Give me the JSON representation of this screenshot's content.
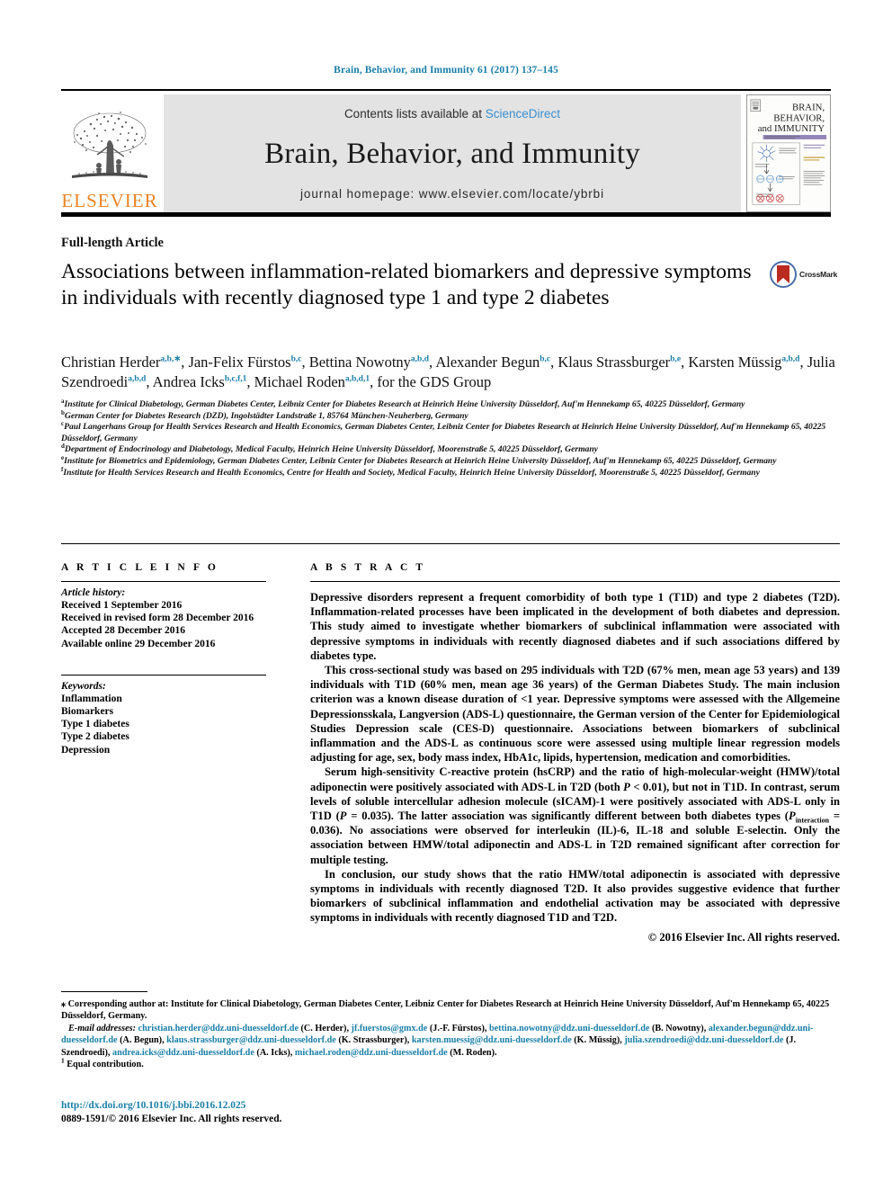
{
  "running_head": "Brain, Behavior, and Immunity 61 (2017) 137–145",
  "masthead": {
    "publisher_name": "ELSEVIER",
    "contents_prefix": "Contents lists available at ",
    "contents_link": "ScienceDirect",
    "journal_name": "Brain, Behavior, and Immunity",
    "homepage": "journal homepage: www.elsevier.com/locate/ybrbi",
    "cover_title_line1": "BRAIN,",
    "cover_title_line2": "BEHAVIOR,",
    "cover_title_line3": "and IMMUNITY"
  },
  "article": {
    "type": "Full-length Article",
    "title": "Associations between inflammation-related biomarkers and depressive symptoms in individuals with recently diagnosed type 1 and type 2 diabetes",
    "crossmark_label": "CrossMark"
  },
  "authors": [
    {
      "name": "Christian Herder",
      "sup": "a,b,∗",
      "sep": ", "
    },
    {
      "name": "Jan-Felix Fürstos",
      "sup": "b,c",
      "sep": ", "
    },
    {
      "name": "Bettina Nowotny",
      "sup": "a,b,d",
      "sep": ", "
    },
    {
      "name": "Alexander Begun",
      "sup": "b,c",
      "sep": ", "
    },
    {
      "name": "Klaus Strassburger",
      "sup": "b,e",
      "sep": ", "
    },
    {
      "name": "Karsten Müssig",
      "sup": "a,b,d",
      "sep": ", "
    },
    {
      "name": "Julia Szendroedi",
      "sup": "a,b,d",
      "sep": ", "
    },
    {
      "name": "Andrea Icks",
      "sup": "b,c,f,1",
      "sep": ", "
    },
    {
      "name": "Michael Roden",
      "sup": "a,b,d,1",
      "sep": ", "
    }
  ],
  "authors_trailing": "for the GDS Group",
  "affiliations": [
    {
      "marker": "a",
      "text": "Institute for Clinical Diabetology, German Diabetes Center, Leibniz Center for Diabetes Research at Heinrich Heine University Düsseldorf, Auf'm Hennekamp 65, 40225 Düsseldorf, Germany"
    },
    {
      "marker": "b",
      "text": "German Center for Diabetes Research (DZD), Ingolstädter Landstraße 1, 85764 München-Neuherberg, Germany"
    },
    {
      "marker": "c",
      "text": "Paul Langerhans Group for Health Services Research and Health Economics, German Diabetes Center, Leibniz Center for Diabetes Research at Heinrich Heine University Düsseldorf, Auf'm Hennekamp 65, 40225 Düsseldorf, Germany"
    },
    {
      "marker": "d",
      "text": "Department of Endocrinology and Diabetology, Medical Faculty, Heinrich Heine University Düsseldorf, Moorenstraße 5, 40225 Düsseldorf, Germany"
    },
    {
      "marker": "e",
      "text": "Institute for Biometrics and Epidemiology, German Diabetes Center, Leibniz Center for Diabetes Research at Heinrich Heine University Düsseldorf, Auf'm Hennekamp 65, 40225 Düsseldorf, Germany"
    },
    {
      "marker": "f",
      "text": "Institute for Health Services Research and Health Economics, Centre for Health and Society, Medical Faculty, Heinrich Heine University Düsseldorf, Moorenstraße 5, 40225 Düsseldorf, Germany"
    }
  ],
  "article_info": {
    "heading": "A R T I C L E  I N F O",
    "history_label": "Article history:",
    "history": [
      "Received 1 September 2016",
      "Received in revised form 28 December 2016",
      "Accepted 28 December 2016",
      "Available online 29 December 2016"
    ],
    "keywords_label": "Keywords:",
    "keywords": [
      "Inflammation",
      "Biomarkers",
      "Type 1 diabetes",
      "Type 2 diabetes",
      "Depression"
    ]
  },
  "abstract": {
    "heading": "A B S T R A C T",
    "paragraph1": "Depressive disorders represent a frequent comorbidity of both type 1 (T1D) and type 2 diabetes (T2D). Inflammation-related processes have been implicated in the development of both diabetes and depression. This study aimed to investigate whether biomarkers of subclinical inflammation were associated with depressive symptoms in individuals with recently diagnosed diabetes and if such associations differed by diabetes type.",
    "paragraph2": "This cross-sectional study was based on 295 individuals with T2D (67% men, mean age 53 years) and 139 individuals with T1D (60% men, mean age 36 years) of the German Diabetes Study. The main inclusion criterion was a known disease duration of <1 year. Depressive symptoms were assessed with the Allgemeine Depressionsskala, Langversion (ADS-L) questionnaire, the German version of the Center for Epidemiological Studies Depression scale (CES-D) questionnaire. Associations between biomarkers of subclinical inflammation and the ADS-L as continuous score were assessed using multiple linear regression models adjusting for age, sex, body mass index, HbA1c, lipids, hypertension, medication and comorbidities.",
    "paragraph3_a": "Serum high-sensitivity C-reactive protein (hsCRP) and the ratio of high-molecular-weight (HMW)/total adiponectin were positively associated with ADS-L in T2D (both ",
    "paragraph3_p1": "P",
    "paragraph3_b": " < 0.01), but not in T1D. In contrast, serum levels of soluble intercellular adhesion molecule (sICAM)-1 were positively associated with ADS-L only in T1D (",
    "paragraph3_p2": "P",
    "paragraph3_c": " = 0.035). The latter association was significantly different between both diabetes types (",
    "paragraph3_p3": "P",
    "paragraph3_sub": "interaction",
    "paragraph3_d": " = 0.036). No associations were observed for interleukin (IL)-6, IL-18 and soluble E-selectin. Only the association between HMW/total adiponectin and ADS-L in T2D remained significant after correction for multiple testing.",
    "paragraph4": "In conclusion, our study shows that the ratio HMW/total adiponectin is associated with depressive symptoms in individuals with recently diagnosed T2D. It also provides suggestive evidence that further biomarkers of subclinical inflammation and endothelial activation may be associated with depressive symptoms in individuals with recently diagnosed T1D and T2D.",
    "copyright": "© 2016 Elsevier Inc. All rights reserved."
  },
  "footnotes": {
    "corresponding": "⁎ Corresponding author at: Institute for Clinical Diabetology, German Diabetes Center, Leibniz Center for Diabetes Research at Heinrich Heine University Düsseldorf, Auf'm Hennekamp 65, 40225 Düsseldorf, Germany.",
    "email_label": "E-mail addresses:",
    "emails": [
      {
        "address": "christian.herder@ddz.uni-duesseldorf.de",
        "person": "(C. Herder)"
      },
      {
        "address": "jf.fuerstos@gmx.de",
        "person": "(J.-F. Fürstos)"
      },
      {
        "address": "bettina.nowotny@ddz.uni-duesseldorf.de",
        "person": "(B. Nowotny)"
      },
      {
        "address": "alexander.begun@ddz.uni-duesseldorf.de",
        "person": "(A. Begun)"
      },
      {
        "address": "klaus.strassburger@ddz.uni-duesseldorf.de",
        "person": "(K. Strassburger)"
      },
      {
        "address": "karsten.muessig@ddz.uni-duesseldorf.de",
        "person": "(K. Müssig)"
      },
      {
        "address": "julia.szendroedi@ddz.uni-duesseldorf.de",
        "person": "(J. Szendroedi)"
      },
      {
        "address": "andrea.icks@ddz.uni-duesseldorf.de",
        "person": "(A. Icks)"
      },
      {
        "address": "michael.roden@ddz.uni-duesseldorf.de",
        "person": "(M. Roden)"
      }
    ],
    "equal_contribution_marker": "1",
    "equal_contribution": "Equal contribution."
  },
  "bottom": {
    "doi": "http://dx.doi.org/10.1016/j.bbi.2016.12.025",
    "issn": "0889-1591/© 2016 Elsevier Inc. All rights reserved."
  },
  "colors": {
    "link_blue": "#1a7fa8",
    "sciencedirect_blue": "#3a8fd0",
    "elsevier_orange": "#ea8324",
    "masthead_gray": "#e3e3e3"
  }
}
